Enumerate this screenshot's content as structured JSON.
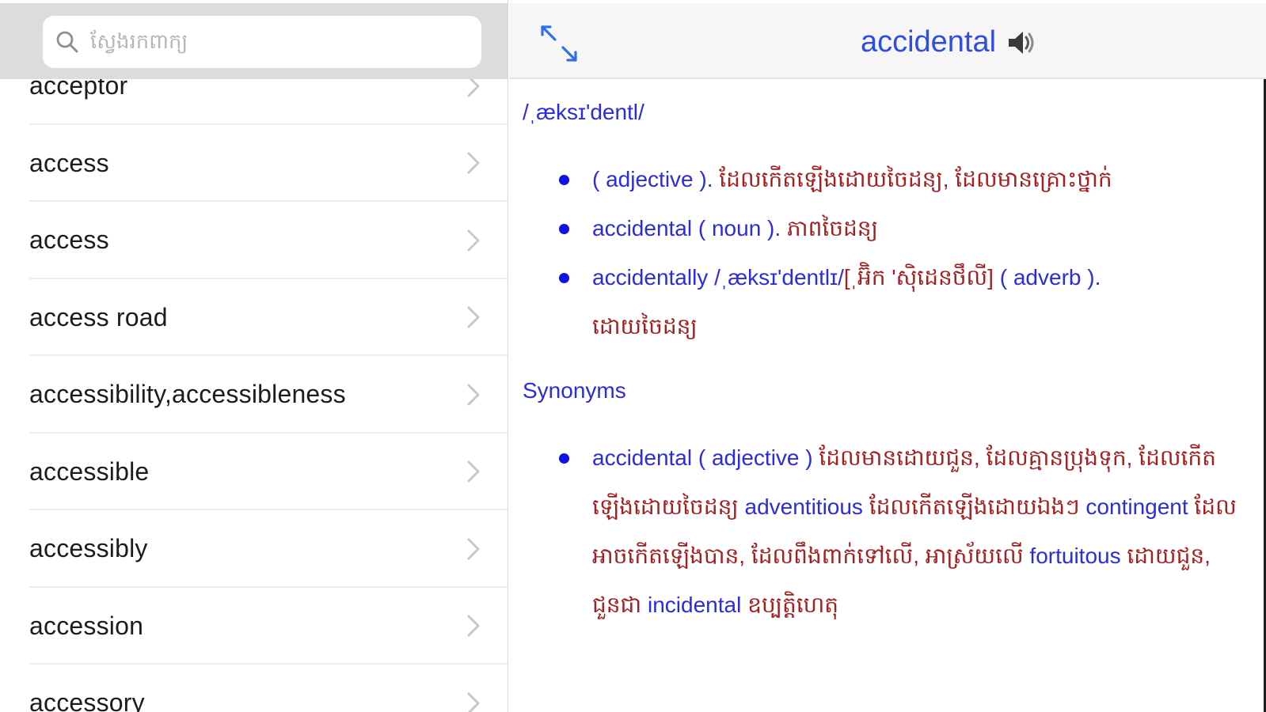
{
  "search": {
    "placeholder": "ស្វែងរកពាក្យ",
    "icon": "search-icon"
  },
  "word_list": [
    {
      "label": "acceptor"
    },
    {
      "label": "access"
    },
    {
      "label": "access"
    },
    {
      "label": "access road"
    },
    {
      "label": "accessibility,accessibleness"
    },
    {
      "label": "accessible"
    },
    {
      "label": "accessibly"
    },
    {
      "label": "accession"
    },
    {
      "label": "accessory"
    }
  ],
  "entry": {
    "title": "accidental",
    "pronunciation": "/ˌæksɪ'dentl/",
    "definitions": [
      {
        "pos": "( adjective ).",
        "text": " ដែលកើតឡើងដោយចៃដន្យ, ដែលមានគ្រោះថ្នាក់"
      },
      {
        "word": "accidental",
        "pos": "( noun ).",
        "text": " ភាពចៃដន្យ"
      },
      {
        "word": "accidentally",
        "pron": "/ˌæksɪ'dentlɪ/",
        "khmer_pron": "[ˌអ៊ិក 'ស៊ិដេនថឹលី]",
        "pos": "( adverb ).",
        "text": "ដោយចៃដន្យ"
      }
    ],
    "synonyms_heading": "Synonyms",
    "synonyms": {
      "word": "accidental",
      "pos": "( adjective )",
      "def1": " ដែលមានដោយជួន, ដែលគ្មានប្រុងទុក, ដែលកើតឡើងដោយចៃដន្យ ",
      "syn1": "adventitious",
      "def2": " ដែលកើតឡើងដោយឯងៗ ",
      "syn2": "contingent",
      "def3": " ដែលអាចកើតឡើងបាន, ដែលពឹងពាក់ទៅលើ, អាស្រ័យលើ ",
      "syn3": "fortuitous",
      "def4": " ដោយជួន, ជួនជា ",
      "syn4": "incidental",
      "def5": " ឧប្បត្តិហេតុ"
    }
  },
  "colors": {
    "accent": "#2b2be0",
    "khmer_text": "#a41f1f",
    "search_bg": "#dcdcdc",
    "nav_bg": "#f6f6f6"
  }
}
